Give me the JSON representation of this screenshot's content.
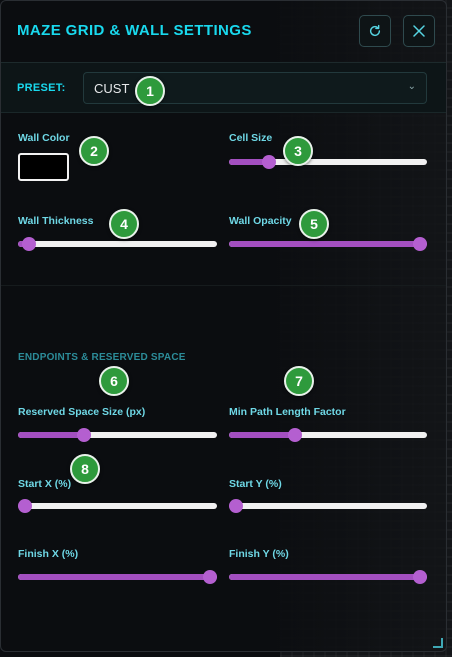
{
  "header": {
    "title": "MAZE GRID & WALL SETTINGS",
    "reset_icon": "refresh-icon",
    "close_icon": "close-icon"
  },
  "preset": {
    "label": "PRESET:",
    "value": "CUST"
  },
  "wall": {
    "color_label": "Wall Color",
    "color_value": "#000000",
    "cell_size_label": "Cell Size",
    "cell_size_level": 0.18,
    "thickness_label": "Wall Thickness",
    "thickness_level": 0.02,
    "opacity_label": "Wall Opacity",
    "opacity_level": 1.0
  },
  "endpoints": {
    "section_title": "ENDPOINTS & RESERVED SPACE",
    "reserved_label": "Reserved Space Size (px)",
    "reserved_level": 0.32,
    "min_path_label": "Min Path Length Factor",
    "min_path_level": 0.32,
    "start_x_label": "Start X (%)",
    "start_x_level": 0.0,
    "start_y_label": "Start Y (%)",
    "start_y_level": 0.0,
    "finish_x_label": "Finish X (%)",
    "finish_x_level": 1.0,
    "finish_y_label": "Finish Y (%)",
    "finish_y_level": 1.0
  },
  "badges": [
    "1",
    "2",
    "3",
    "4",
    "5",
    "6",
    "7",
    "8"
  ],
  "colors": {
    "accent": "#19d9ee",
    "slider_fill": "#a34fc0",
    "badge": "#2e9a3c"
  }
}
